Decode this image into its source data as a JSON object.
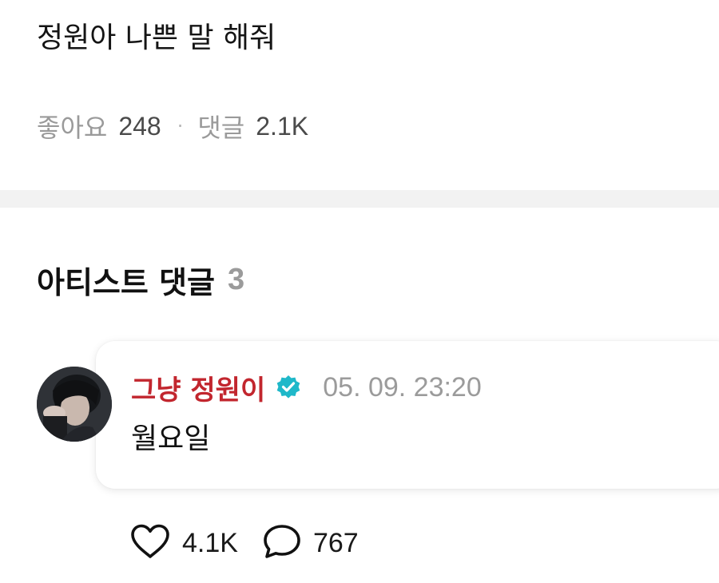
{
  "post": {
    "title": "정원아 나쁜 말 해줘",
    "likes_label": "좋아요",
    "likes_count": "248",
    "separator": "·",
    "comments_label": "댓글",
    "comments_count": "2.1K"
  },
  "artist_comments": {
    "title": "아티스트 댓글",
    "count": "3"
  },
  "comment": {
    "author": "그냥 정원이",
    "verified_icon": "verified-badge-icon",
    "timestamp": "05. 09. 23:20",
    "body": "월요일",
    "like_icon": "heart-icon",
    "like_count": "4.1K",
    "reply_icon": "speech-bubble-icon",
    "reply_count": "767"
  },
  "colors": {
    "author_name": "#c2262e",
    "verified_badge": "#1fb8c9",
    "muted_text": "#9b9b9b",
    "divider": "#f2f2f2"
  }
}
